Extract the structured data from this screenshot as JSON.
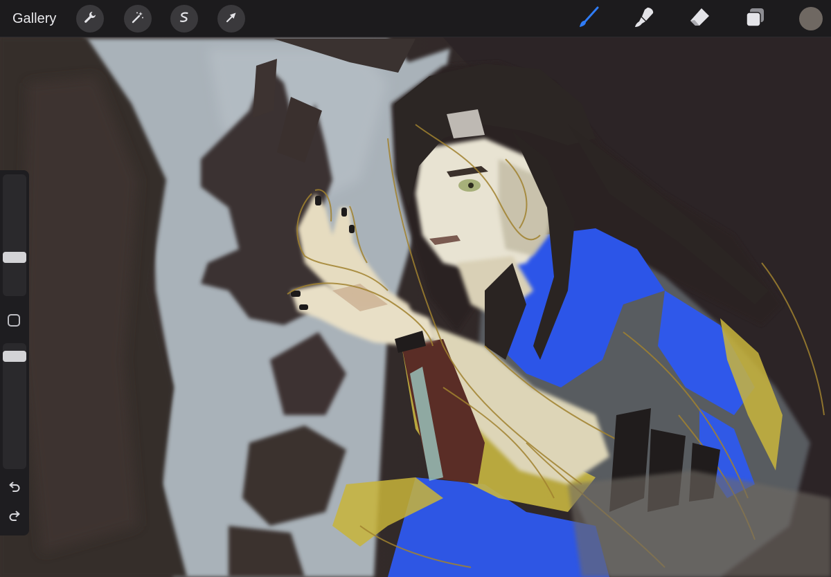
{
  "app": {
    "gallery_label": "Gallery"
  },
  "toolbar": {
    "actions_icon": "wrench-icon",
    "adjustments_icon": "magic-wand-icon",
    "selection_icon": "selection-s-icon",
    "transform_icon": "arrow-cursor-icon",
    "brush_icon": "brush-icon",
    "smudge_icon": "smudge-icon",
    "eraser_icon": "eraser-icon",
    "layers_icon": "layers-icon",
    "active_tool": "brush",
    "current_color": "#6f6862",
    "accent_color": "#2f7cf6"
  },
  "sidebar": {
    "brush_size_slider": "brush-size",
    "opacity_slider": "brush-opacity",
    "modifier_icon": "square-icon",
    "undo_icon": "undo-icon",
    "redo_icon": "redo-icon"
  },
  "artwork": {
    "palette": {
      "wall": "#a8b1b8",
      "shadow": "#2f2927",
      "hair": "#2b2524",
      "skin": "#e7e2cf",
      "shirt_blue": "#2f57e8",
      "ochre": "#c3b13a",
      "shirt_gray": "#54575b",
      "sketch": "#9a7a2e"
    }
  }
}
